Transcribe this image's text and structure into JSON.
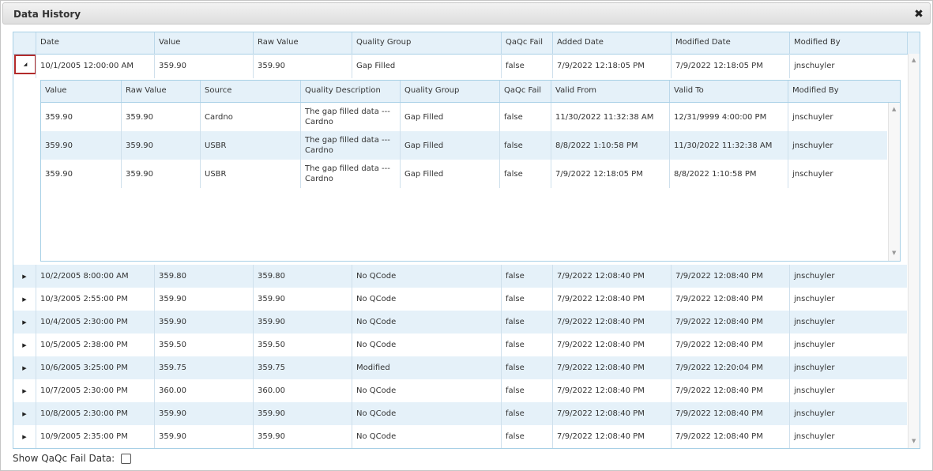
{
  "dialog": {
    "title": "Data History",
    "close_icon": "close-icon"
  },
  "grid": {
    "columns": [
      "Date",
      "Value",
      "Raw Value",
      "Quality Group",
      "QaQc Fail",
      "Added Date",
      "Modified Date",
      "Modified By"
    ],
    "expanded_row": {
      "date": "10/1/2005 12:00:00 AM",
      "value": "359.90",
      "raw_value": "359.90",
      "quality_group": "Gap Filled",
      "qaqc_fail": "false",
      "added_date": "7/9/2022 12:18:05 PM",
      "modified_date": "7/9/2022 12:18:05 PM",
      "modified_by": "jnschuyler"
    },
    "detail": {
      "columns": [
        "Value",
        "Raw Value",
        "Source",
        "Quality Description",
        "Quality Group",
        "QaQc Fail",
        "Valid From",
        "Valid To",
        "Modified By"
      ],
      "rows": [
        [
          "359.90",
          "359.90",
          "Cardno",
          "The gap filled data --- Cardno",
          "Gap Filled",
          "false",
          "11/30/2022 11:32:38 AM",
          "12/31/9999 4:00:00 PM",
          "jnschuyler"
        ],
        [
          "359.90",
          "359.90",
          "USBR",
          "The gap filled data --- Cardno",
          "Gap Filled",
          "false",
          "8/8/2022 1:10:58 PM",
          "11/30/2022 11:32:38 AM",
          "jnschuyler"
        ],
        [
          "359.90",
          "359.90",
          "USBR",
          "The gap filled data --- Cardno",
          "Gap Filled",
          "false",
          "7/9/2022 12:18:05 PM",
          "8/8/2022 1:10:58 PM",
          "jnschuyler"
        ]
      ]
    },
    "rows": [
      [
        "10/2/2005 8:00:00 AM",
        "359.80",
        "359.80",
        "No QCode",
        "false",
        "7/9/2022 12:08:40 PM",
        "7/9/2022 12:08:40 PM",
        "jnschuyler"
      ],
      [
        "10/3/2005 2:55:00 PM",
        "359.90",
        "359.90",
        "No QCode",
        "false",
        "7/9/2022 12:08:40 PM",
        "7/9/2022 12:08:40 PM",
        "jnschuyler"
      ],
      [
        "10/4/2005 2:30:00 PM",
        "359.90",
        "359.90",
        "No QCode",
        "false",
        "7/9/2022 12:08:40 PM",
        "7/9/2022 12:08:40 PM",
        "jnschuyler"
      ],
      [
        "10/5/2005 2:38:00 PM",
        "359.50",
        "359.50",
        "No QCode",
        "false",
        "7/9/2022 12:08:40 PM",
        "7/9/2022 12:08:40 PM",
        "jnschuyler"
      ],
      [
        "10/6/2005 3:25:00 PM",
        "359.75",
        "359.75",
        "Modified",
        "false",
        "7/9/2022 12:08:40 PM",
        "7/9/2022 12:20:04 PM",
        "jnschuyler"
      ],
      [
        "10/7/2005 2:30:00 PM",
        "360.00",
        "360.00",
        "No QCode",
        "false",
        "7/9/2022 12:08:40 PM",
        "7/9/2022 12:08:40 PM",
        "jnschuyler"
      ],
      [
        "10/8/2005 2:30:00 PM",
        "359.90",
        "359.90",
        "No QCode",
        "false",
        "7/9/2022 12:08:40 PM",
        "7/9/2022 12:08:40 PM",
        "jnschuyler"
      ],
      [
        "10/9/2005 2:35:00 PM",
        "359.90",
        "359.90",
        "No QCode",
        "false",
        "7/9/2022 12:08:40 PM",
        "7/9/2022 12:08:40 PM",
        "jnschuyler"
      ]
    ]
  },
  "footer": {
    "label": "Show QaQc Fail Data:",
    "checked": false
  },
  "icons": {
    "expand": "caret-right-icon",
    "collapse": "caret-down-icon",
    "close": "close-icon"
  },
  "colors": {
    "header_bg": "#e5f1f9",
    "border": "#a8d0e6",
    "alt_row": "#e5f1f9",
    "highlight": "#b32b2b"
  }
}
